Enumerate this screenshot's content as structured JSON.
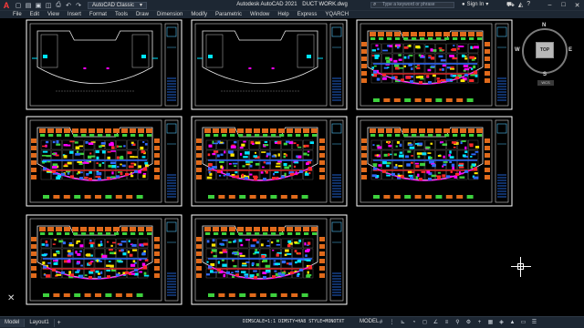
{
  "titlebar": {
    "logo": "A",
    "workspace": "AutoCAD Classic",
    "app_name": "Autodesk AutoCAD 2021",
    "file_name": "DUCT WORK.dwg",
    "search_placeholder": "Type a keyword or phrase",
    "signin": "Sign In"
  },
  "menu": [
    "File",
    "Edit",
    "View",
    "Insert",
    "Format",
    "Tools",
    "Draw",
    "Dimension",
    "Modify",
    "Parametric",
    "Window",
    "Help",
    "Express",
    "YQARCH"
  ],
  "viewcube": {
    "north": "N",
    "south": "S",
    "east": "E",
    "west": "W",
    "top": "TOP",
    "wcs": "WCS"
  },
  "status": {
    "tabs": [
      "Model",
      "Layout1"
    ],
    "add_tab": "+",
    "command": "DIMSCALE=1:1 DIMSTY=HA8 STYLE=MONOTXT",
    "model_label": "MODEL"
  },
  "colors": {
    "chrome": "#1d2733",
    "canvas": "#000000",
    "sheet_border": "#ffffff",
    "duct_red": "#ff2a2a",
    "duct_blue": "#2f6bff",
    "duct_cyan": "#00e5ff",
    "duct_magenta": "#ff00ff",
    "label_orange": "#e06a1b",
    "label_green": "#3dd13d",
    "wall_white": "#e8e8e8",
    "yellow": "#ffe600"
  }
}
